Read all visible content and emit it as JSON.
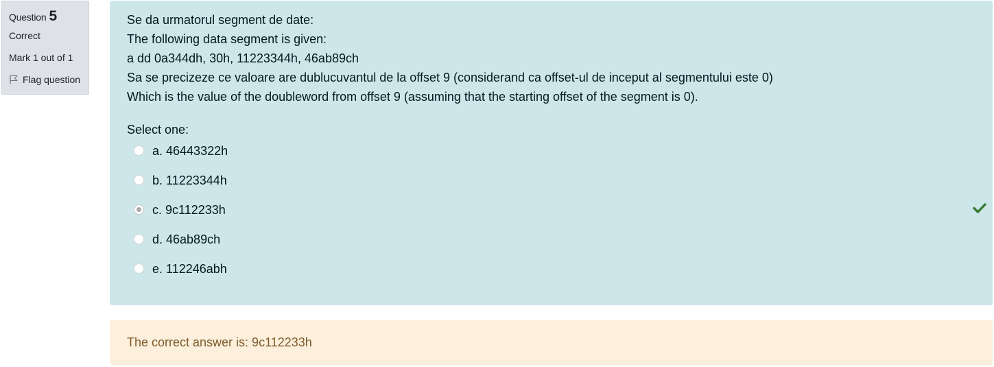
{
  "info": {
    "question_label": "Question",
    "question_number": "5",
    "state": "Correct",
    "grade": "Mark 1 out of 1",
    "flag_label": "Flag question"
  },
  "question": {
    "lines": [
      "Se da urmatorul segment de date:",
      "The following data segment is given:",
      "a dd 0a344dh, 30h, 11223344h, 46ab89ch",
      "Sa se precizeze ce valoare are dublucuvantul de la offset 9  (considerand ca offset-ul de inceput al segmentului este 0)",
      "Which is the value of the doubleword from offset 9 (assuming that the starting offset of the segment is 0)."
    ],
    "prompt": "Select one:",
    "answers": [
      {
        "label": "a. 46443322h",
        "selected": false
      },
      {
        "label": "b. 11223344h",
        "selected": false
      },
      {
        "label": "c. 9c112233h",
        "selected": true,
        "correct": true
      },
      {
        "label": "d. 46ab89ch",
        "selected": false
      },
      {
        "label": "e. 112246abh",
        "selected": false
      }
    ]
  },
  "feedback": {
    "right_answer": "The correct answer is: 9c112233h"
  },
  "colors": {
    "formulation_bg": "#cce6ea",
    "feedback_bg": "#fcefdc",
    "info_bg": "#dee2e6",
    "correct_icon": "#357a32"
  },
  "icons": {
    "flag": "flag-icon",
    "correct": "check-icon"
  }
}
